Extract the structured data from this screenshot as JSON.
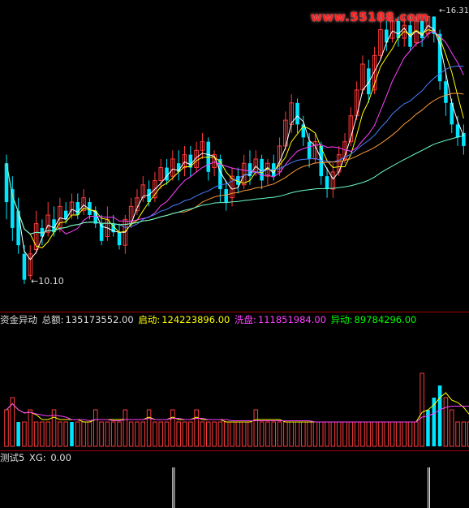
{
  "top_strip": "",
  "watermark": "www.55188.com",
  "price_pane": {
    "high_label": "16.31",
    "low_label": "10.10"
  },
  "volume_pane": {
    "name": "资金异动",
    "total_label": "总额:",
    "total_value": "135173552.00",
    "start_label": "启动:",
    "start_value": "124223896.00",
    "wash_label": "洗盘:",
    "wash_value": "111851984.00",
    "abnormal_label": "异动:",
    "abnormal_value": "89784296.00"
  },
  "test_pane": {
    "name": "测试5",
    "xg_label": "XG:",
    "xg_value": "0.00"
  },
  "colors": {
    "background": "#000000",
    "up": "#ff3b3b",
    "down": "#00e5ff",
    "total": "#ffffff",
    "start": "#ffff00",
    "wash": "#ff40ff",
    "abnormal": "#00ff00",
    "separator": "#a00000"
  },
  "chart_data": {
    "type": "candlestick",
    "price_range": [
      10.1,
      16.31
    ],
    "candles": [
      [
        12.0,
        12.9,
        11.6,
        13.1,
        "down"
      ],
      [
        12.3,
        11.4,
        11.1,
        12.6,
        "down"
      ],
      [
        11.8,
        11.0,
        10.8,
        12.1,
        "down"
      ],
      [
        10.8,
        10.2,
        10.1,
        11.0,
        "down"
      ],
      [
        10.3,
        10.8,
        10.2,
        11.0,
        "up"
      ],
      [
        10.9,
        11.5,
        10.8,
        11.8,
        "up"
      ],
      [
        11.4,
        11.2,
        11.0,
        11.6,
        "down"
      ],
      [
        11.3,
        11.7,
        11.2,
        12.0,
        "up"
      ],
      [
        11.6,
        11.3,
        11.2,
        11.9,
        "down"
      ],
      [
        11.4,
        11.9,
        11.3,
        12.1,
        "up"
      ],
      [
        11.8,
        11.6,
        11.5,
        12.0,
        "down"
      ],
      [
        11.7,
        12.0,
        11.6,
        12.2,
        "up"
      ],
      [
        12.0,
        11.7,
        11.6,
        12.2,
        "down"
      ],
      [
        11.8,
        12.1,
        11.7,
        12.3,
        "up"
      ],
      [
        12.0,
        11.7,
        11.6,
        12.1,
        "down"
      ],
      [
        11.8,
        11.5,
        11.4,
        11.9,
        "down"
      ],
      [
        11.5,
        11.1,
        11.0,
        11.7,
        "down"
      ],
      [
        11.2,
        11.6,
        11.1,
        11.9,
        "up"
      ],
      [
        11.5,
        11.3,
        11.2,
        11.7,
        "down"
      ],
      [
        11.3,
        11.0,
        10.9,
        11.5,
        "down"
      ],
      [
        11.0,
        11.6,
        10.8,
        11.7,
        "up"
      ],
      [
        11.5,
        11.9,
        11.4,
        12.1,
        "up"
      ],
      [
        11.8,
        12.1,
        11.7,
        12.3,
        "up"
      ],
      [
        12.1,
        12.4,
        12.0,
        12.6,
        "up"
      ],
      [
        12.3,
        12.0,
        11.9,
        12.5,
        "down"
      ],
      [
        12.1,
        12.5,
        12.0,
        12.7,
        "up"
      ],
      [
        12.5,
        12.8,
        12.3,
        13.0,
        "up"
      ],
      [
        12.8,
        12.5,
        12.4,
        13.0,
        "down"
      ],
      [
        12.6,
        13.0,
        12.5,
        13.2,
        "up"
      ],
      [
        12.9,
        12.7,
        12.5,
        13.2,
        "down"
      ],
      [
        12.8,
        13.1,
        12.6,
        13.3,
        "up"
      ],
      [
        13.1,
        12.8,
        12.6,
        13.3,
        "down"
      ],
      [
        12.8,
        13.2,
        12.7,
        13.4,
        "up"
      ],
      [
        13.2,
        13.4,
        13.0,
        13.6,
        "up"
      ],
      [
        13.4,
        12.7,
        12.5,
        13.5,
        "down"
      ],
      [
        12.8,
        13.1,
        12.6,
        13.2,
        "up"
      ],
      [
        13.0,
        12.3,
        12.0,
        13.1,
        "down"
      ],
      [
        12.3,
        12.0,
        11.8,
        12.5,
        "down"
      ],
      [
        12.1,
        12.6,
        11.9,
        12.8,
        "up"
      ],
      [
        12.6,
        12.4,
        12.2,
        12.8,
        "down"
      ],
      [
        12.4,
        12.9,
        12.3,
        13.1,
        "up"
      ],
      [
        12.9,
        12.6,
        12.4,
        13.2,
        "down"
      ],
      [
        12.7,
        13.0,
        12.6,
        13.2,
        "up"
      ],
      [
        13.0,
        12.5,
        12.3,
        13.1,
        "down"
      ],
      [
        12.6,
        12.9,
        12.4,
        13.0,
        "up"
      ],
      [
        12.9,
        12.6,
        12.5,
        13.1,
        "down"
      ],
      [
        12.7,
        13.3,
        12.6,
        13.5,
        "up"
      ],
      [
        13.3,
        13.9,
        13.2,
        14.1,
        "up"
      ],
      [
        13.8,
        14.3,
        13.6,
        14.5,
        "up"
      ],
      [
        14.3,
        13.8,
        13.6,
        14.4,
        "down"
      ],
      [
        13.8,
        13.5,
        13.3,
        14.0,
        "down"
      ],
      [
        13.4,
        13.0,
        12.8,
        13.6,
        "down"
      ],
      [
        13.0,
        13.4,
        12.9,
        13.6,
        "up"
      ],
      [
        13.3,
        12.6,
        12.4,
        13.4,
        "down"
      ],
      [
        12.6,
        12.3,
        12.1,
        12.8,
        "down"
      ],
      [
        12.3,
        12.7,
        12.1,
        12.9,
        "up"
      ],
      [
        12.7,
        13.1,
        12.6,
        13.3,
        "up"
      ],
      [
        13.0,
        13.4,
        12.9,
        13.6,
        "up"
      ],
      [
        13.4,
        14.0,
        13.3,
        14.2,
        "up"
      ],
      [
        14.0,
        14.6,
        13.9,
        14.8,
        "up"
      ],
      [
        14.6,
        15.2,
        14.5,
        15.4,
        "up"
      ],
      [
        15.1,
        14.5,
        14.3,
        15.3,
        "down"
      ],
      [
        14.6,
        15.4,
        14.5,
        15.6,
        "up"
      ],
      [
        15.4,
        16.0,
        15.3,
        16.2,
        "up"
      ],
      [
        16.0,
        15.7,
        15.5,
        16.2,
        "down"
      ],
      [
        15.8,
        16.2,
        15.7,
        16.31,
        "up"
      ],
      [
        16.2,
        15.8,
        15.6,
        16.3,
        "down"
      ],
      [
        15.8,
        16.1,
        15.6,
        16.3,
        "up"
      ],
      [
        16.1,
        15.6,
        15.5,
        16.3,
        "down"
      ],
      [
        15.7,
        16.2,
        15.6,
        16.3,
        "up"
      ],
      [
        16.2,
        15.8,
        15.6,
        16.3,
        "down"
      ],
      [
        15.9,
        16.3,
        15.8,
        16.31,
        "up"
      ],
      [
        16.3,
        15.9,
        15.7,
        16.31,
        "down"
      ],
      [
        15.9,
        14.8,
        14.6,
        16.0,
        "down"
      ],
      [
        14.8,
        14.3,
        14.0,
        15.0,
        "down"
      ],
      [
        14.3,
        13.8,
        13.6,
        14.4,
        "down"
      ],
      [
        13.8,
        13.5,
        13.3,
        14.0,
        "down"
      ],
      [
        13.6,
        13.3,
        13.1,
        13.8,
        "down"
      ]
    ],
    "volume_bars": [
      [
        3,
        "up"
      ],
      [
        4,
        "up"
      ],
      [
        2,
        "down"
      ],
      [
        2,
        "up"
      ],
      [
        3,
        "up"
      ],
      [
        2,
        "up"
      ],
      [
        2,
        "up"
      ],
      [
        2,
        "up"
      ],
      [
        3,
        "up"
      ],
      [
        2,
        "up"
      ],
      [
        2,
        "up"
      ],
      [
        2,
        "down"
      ],
      [
        2,
        "up"
      ],
      [
        2,
        "up"
      ],
      [
        2,
        "up"
      ],
      [
        3,
        "up"
      ],
      [
        2,
        "up"
      ],
      [
        2,
        "up"
      ],
      [
        2,
        "up"
      ],
      [
        2,
        "up"
      ],
      [
        3,
        "up"
      ],
      [
        2,
        "up"
      ],
      [
        2,
        "up"
      ],
      [
        2,
        "up"
      ],
      [
        3,
        "up"
      ],
      [
        2,
        "up"
      ],
      [
        2,
        "up"
      ],
      [
        2,
        "up"
      ],
      [
        3,
        "up"
      ],
      [
        2,
        "up"
      ],
      [
        2,
        "up"
      ],
      [
        2,
        "up"
      ],
      [
        3,
        "up"
      ],
      [
        2,
        "up"
      ],
      [
        2,
        "up"
      ],
      [
        2,
        "up"
      ],
      [
        2,
        "up"
      ],
      [
        2,
        "up"
      ],
      [
        2,
        "up"
      ],
      [
        2,
        "up"
      ],
      [
        2,
        "up"
      ],
      [
        2,
        "up"
      ],
      [
        3,
        "up"
      ],
      [
        2,
        "up"
      ],
      [
        2,
        "up"
      ],
      [
        2,
        "up"
      ],
      [
        2,
        "up"
      ],
      [
        2,
        "up"
      ],
      [
        2,
        "up"
      ],
      [
        2,
        "up"
      ],
      [
        2,
        "up"
      ],
      [
        2,
        "up"
      ],
      [
        2,
        "up"
      ],
      [
        2,
        "up"
      ],
      [
        2,
        "up"
      ],
      [
        2,
        "up"
      ],
      [
        2,
        "up"
      ],
      [
        2,
        "up"
      ],
      [
        2,
        "up"
      ],
      [
        2,
        "up"
      ],
      [
        2,
        "up"
      ],
      [
        2,
        "up"
      ],
      [
        2,
        "up"
      ],
      [
        2,
        "up"
      ],
      [
        2,
        "up"
      ],
      [
        2,
        "up"
      ],
      [
        2,
        "up"
      ],
      [
        2,
        "up"
      ],
      [
        2,
        "up"
      ],
      [
        2,
        "up"
      ],
      [
        6,
        "up"
      ],
      [
        3,
        "down"
      ],
      [
        4,
        "down"
      ],
      [
        5,
        "down"
      ],
      [
        4,
        "up"
      ],
      [
        3,
        "up"
      ],
      [
        2,
        "up"
      ],
      [
        2,
        "up"
      ],
      [
        2,
        "up"
      ],
      [
        2,
        "up"
      ]
    ]
  }
}
